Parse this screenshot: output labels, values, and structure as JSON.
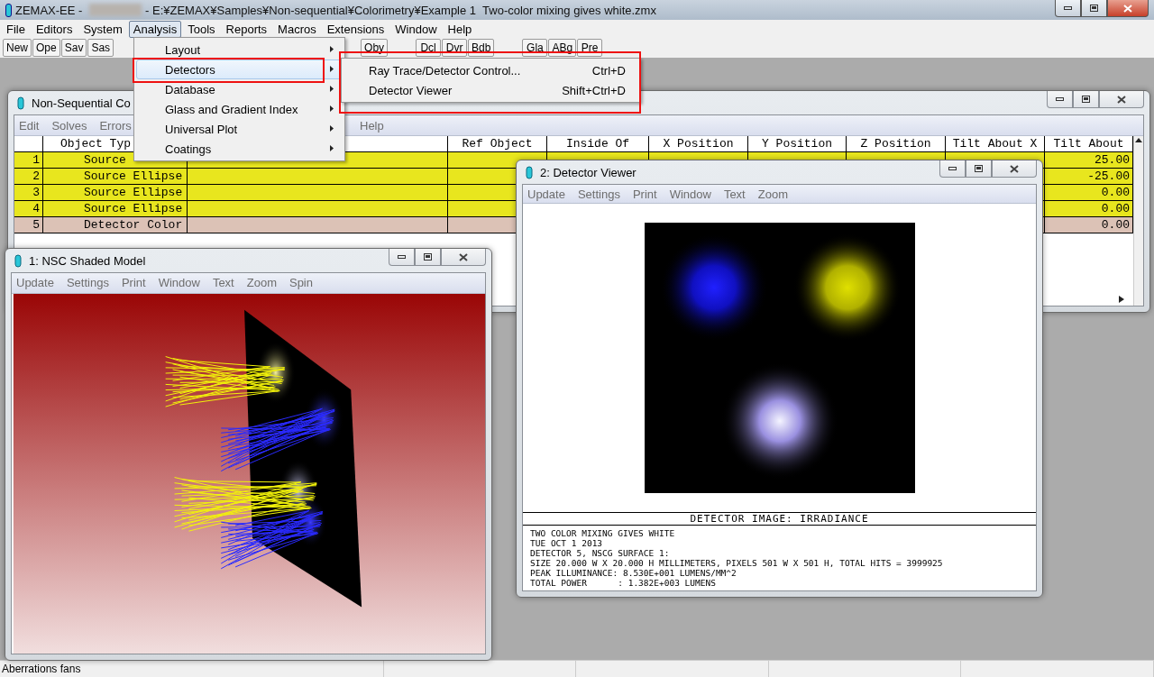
{
  "window": {
    "title": "ZEMAX-EE - ",
    "path": "- E:¥ZEMAX¥Samples¥Non-sequential¥Colorimetry¥Example 1  Two-color mixing gives white.zmx"
  },
  "menu_bar": [
    {
      "label": "File",
      "selected": false
    },
    {
      "label": "Editors",
      "selected": false
    },
    {
      "label": "System",
      "selected": false
    },
    {
      "label": "Analysis",
      "selected": true
    },
    {
      "label": "Tools",
      "selected": false
    },
    {
      "label": "Reports",
      "selected": false
    },
    {
      "label": "Macros",
      "selected": false
    },
    {
      "label": "Extensions",
      "selected": false
    },
    {
      "label": "Window",
      "selected": false
    },
    {
      "label": "Help",
      "selected": false
    }
  ],
  "toolbar": [
    [
      "New",
      "Ope",
      "Sav",
      "Sas"
    ],
    [
      "Oby"
    ],
    [
      "Dcl",
      "Dvr",
      "Bdb"
    ],
    [
      "Gla",
      "ABg",
      "Pre"
    ]
  ],
  "editor": {
    "title": "Non-Sequential Co",
    "menu": [
      "Edit",
      "Solves",
      "Errors"
    ],
    "menu_right": [
      "Help"
    ],
    "columns": [
      null,
      "Object Typ",
      null,
      "Ref Object",
      "Inside Of",
      "X Position",
      "Y Position",
      "Z Position",
      "Tilt About X",
      "Tilt About"
    ],
    "rows": [
      {
        "kind": "source",
        "cells": [
          "1",
          "Source",
          null,
          null,
          null,
          null,
          null,
          null,
          null,
          "25.00"
        ]
      },
      {
        "kind": "source",
        "cells": [
          "2",
          "Source Ellipse",
          null,
          null,
          null,
          null,
          null,
          null,
          null,
          "-25.00"
        ]
      },
      {
        "kind": "source",
        "cells": [
          "3",
          "Source Ellipse",
          null,
          null,
          null,
          null,
          null,
          null,
          null,
          "0.00"
        ]
      },
      {
        "kind": "source",
        "cells": [
          "4",
          "Source Ellipse",
          null,
          null,
          null,
          null,
          null,
          null,
          null,
          "0.00"
        ]
      },
      {
        "kind": "detector",
        "cells": [
          "5",
          "Detector Color",
          null,
          null,
          null,
          null,
          null,
          null,
          null,
          "0.00"
        ]
      }
    ]
  },
  "shaded_model": {
    "title": "1: NSC Shaded Model",
    "menu": [
      "Update",
      "Settings",
      "Print",
      "Window",
      "Text",
      "Zoom",
      "Spin"
    ]
  },
  "detector_viewer": {
    "title": "2: Detector Viewer",
    "menu": [
      "Update",
      "Settings",
      "Print",
      "Window",
      "Text",
      "Zoom"
    ],
    "image_title": "DETECTOR IMAGE: IRRADIANCE",
    "info_lines": [
      "TWO COLOR MIXING GIVES WHITE",
      "TUE OCT 1 2013",
      "DETECTOR 5, NSCG SURFACE 1:",
      "SIZE 20.000 W X 20.000 H MILLIMETERS, PIXELS 501 W X 501 H, TOTAL HITS = 3999925",
      "PEAK ILLUMINANCE: 8.530E+001 LUMENS/MM^2",
      "TOTAL POWER      : 1.382E+003 LUMENS"
    ]
  },
  "analysis_menu": {
    "items": [
      {
        "label": "Layout",
        "selected": false
      },
      {
        "label": "Detectors",
        "selected": true
      },
      {
        "label": "Database",
        "selected": false
      },
      {
        "label": "Glass and Gradient Index",
        "selected": false
      },
      {
        "label": "Universal Plot",
        "selected": false
      },
      {
        "label": "Coatings",
        "selected": false
      }
    ]
  },
  "detectors_submenu": [
    {
      "label": "Ray Trace/Detector Control...",
      "shortcut": "Ctrl+D"
    },
    {
      "label": "Detector Viewer",
      "shortcut": "Shift+Ctrl+D"
    }
  ],
  "status_bar": [
    "Aberrations fans"
  ]
}
